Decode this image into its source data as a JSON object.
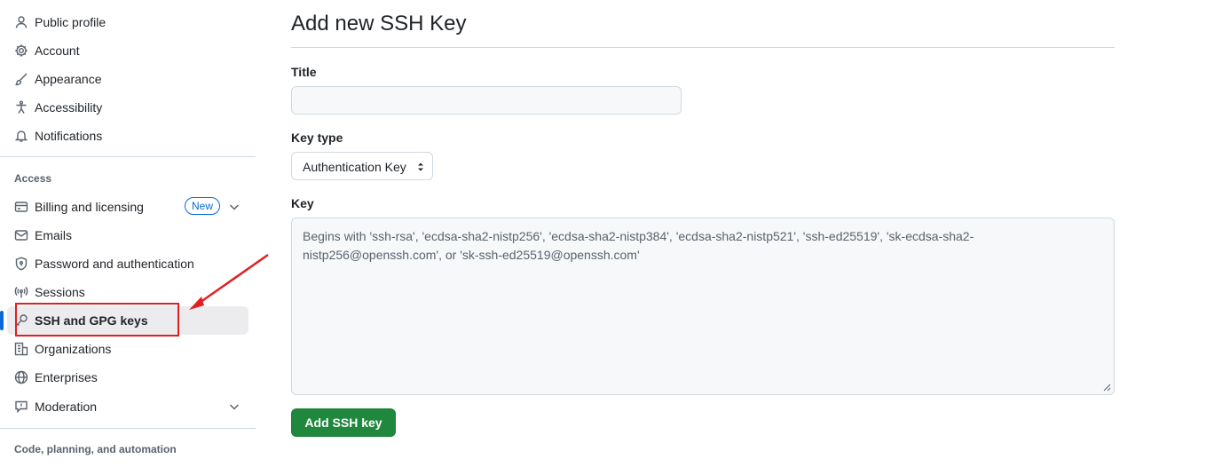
{
  "sidebar": {
    "top_items": [
      {
        "label": "Public profile",
        "icon": "person-icon"
      },
      {
        "label": "Account",
        "icon": "gear-icon"
      },
      {
        "label": "Appearance",
        "icon": "paintbrush-icon"
      },
      {
        "label": "Accessibility",
        "icon": "accessibility-icon"
      },
      {
        "label": "Notifications",
        "icon": "bell-icon"
      }
    ],
    "access_heading": "Access",
    "access_items": [
      {
        "label": "Billing and licensing",
        "icon": "credit-card-icon",
        "badge": "New"
      },
      {
        "label": "Emails",
        "icon": "mail-icon"
      },
      {
        "label": "Password and authentication",
        "icon": "shield-lock-icon"
      },
      {
        "label": "Sessions",
        "icon": "broadcast-icon"
      },
      {
        "label": "SSH and GPG keys",
        "icon": "key-icon",
        "active": true
      },
      {
        "label": "Organizations",
        "icon": "organization-icon"
      },
      {
        "label": "Enterprises",
        "icon": "globe-icon"
      },
      {
        "label": "Moderation",
        "icon": "report-icon"
      }
    ],
    "code_heading": "Code, planning, and automation"
  },
  "main": {
    "title": "Add new SSH Key",
    "title_field": {
      "label": "Title",
      "value": "",
      "placeholder": ""
    },
    "key_type": {
      "label": "Key type",
      "selected": "Authentication Key"
    },
    "key_field": {
      "label": "Key",
      "placeholder": "Begins with 'ssh-rsa', 'ecdsa-sha2-nistp256', 'ecdsa-sha2-nistp384', 'ecdsa-sha2-nistp521', 'ssh-ed25519', 'sk-ecdsa-sha2-nistp256@openssh.com', or 'sk-ssh-ed25519@openssh.com'"
    },
    "submit_label": "Add SSH key"
  },
  "colors": {
    "accent": "#0969da",
    "primary_button": "#1f883d",
    "annotation": "#e02020"
  }
}
